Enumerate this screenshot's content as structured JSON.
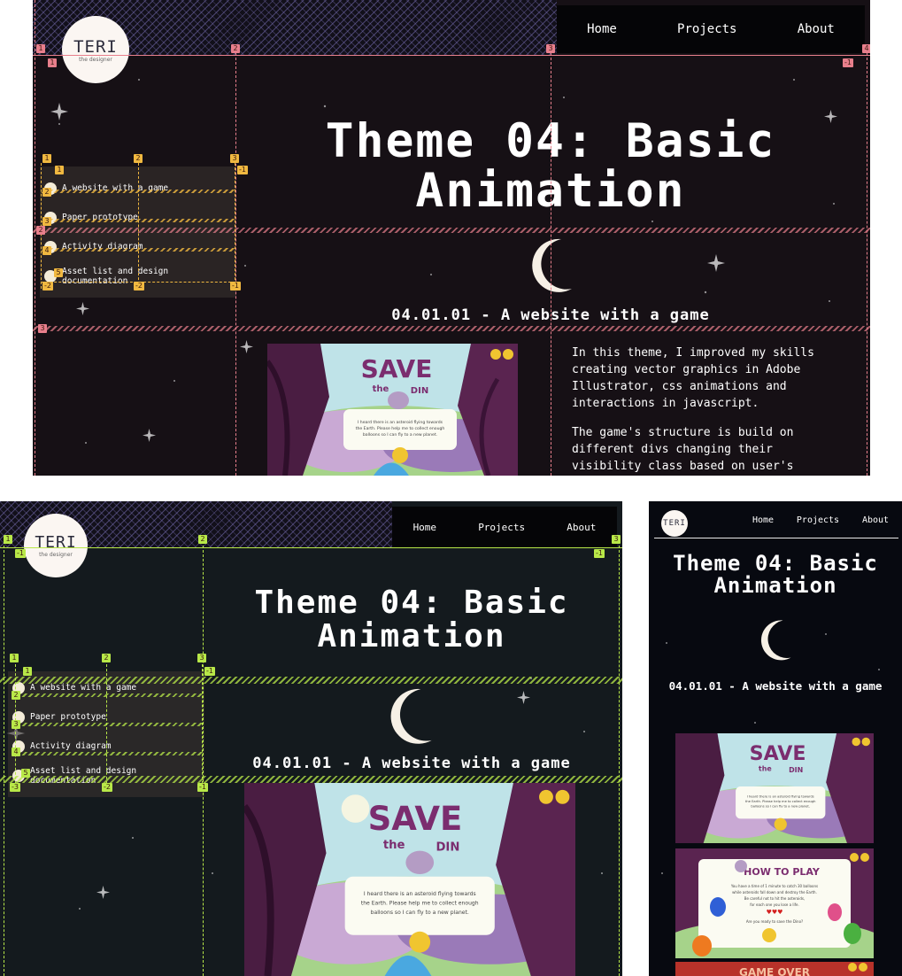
{
  "nav": {
    "home": "Home",
    "projects": "Projects",
    "about": "About"
  },
  "logo": {
    "title": "TERI",
    "tagline": "the designer"
  },
  "page": {
    "title_line1": "Theme 04: Basic",
    "title_line2": "Animation",
    "subtitle": "04.01.01 - A website with a game",
    "paragraph1": "In this theme, I improved my skills creating vector graphics in Adobe Illustrator, css animations and interactions in javascript.",
    "paragraph2": "The game's structure is build on different divs changing their visibility class based on user's"
  },
  "sidebar": {
    "items": [
      {
        "label": "A website with a game"
      },
      {
        "label": "Paper prototype"
      },
      {
        "label": "Activity diagram"
      },
      {
        "label": "Asset list and design documentation"
      }
    ]
  },
  "game": {
    "save_word": "SAVE",
    "the_word": "the",
    "din_word": "DIN",
    "intro": "I heard there is an asteroid flying towards the Earth. Please help me to collect enough balloons so I can fly to a new planet.",
    "howto_title": "HOW TO PLAY",
    "howto_text": "You have a time of 1 minute to catch 30 balloons while asteroids fall down and destroy the Earth. Be careful not to hit the asteroids, for each one you lose a life.",
    "howto_prompt": "Are you ready to save the Dino?",
    "gameover_title": "GAME OVER"
  },
  "overlay_badges": {
    "top": [
      "1",
      "1",
      "2",
      "3",
      "4",
      "-1"
    ],
    "side": [
      "1",
      "1",
      "2",
      "3",
      "-1",
      "2",
      "3",
      "4",
      "5",
      "-2",
      "-2",
      "-1",
      "2",
      "3"
    ],
    "tablet": [
      "1",
      "-1",
      "2",
      "3",
      "-1",
      "1",
      "1",
      "2",
      "3",
      "-1",
      "2",
      "3",
      "4",
      "5",
      "-3",
      "-2",
      "-1"
    ]
  },
  "colors": {
    "grid_red": "#e87f8c",
    "grid_gold": "#f0b840",
    "grid_green": "#b8e848",
    "bg": "#161015"
  }
}
